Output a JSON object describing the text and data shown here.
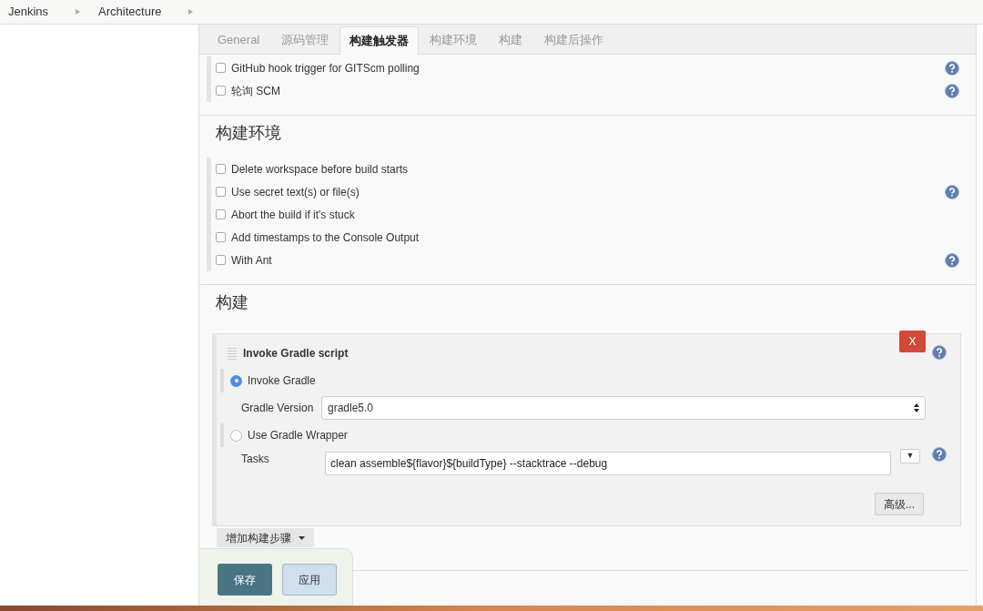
{
  "breadcrumbs": [
    "Jenkins",
    "Architecture"
  ],
  "tabs": [
    {
      "label": "General",
      "selected": false
    },
    {
      "label": "源码管理",
      "selected": false
    },
    {
      "label": "构建触发器",
      "selected": true
    },
    {
      "label": "构建环境",
      "selected": false
    },
    {
      "label": "构建",
      "selected": false
    },
    {
      "label": "构建后操作",
      "selected": false
    }
  ],
  "trigger_options": [
    {
      "label": "GitHub hook trigger for GITScm polling",
      "checked": false,
      "help": true
    },
    {
      "label": "轮询 SCM",
      "checked": false,
      "help": true
    }
  ],
  "environment": {
    "title": "构建环境",
    "options": [
      {
        "label": "Delete workspace before build starts",
        "checked": false,
        "help": false
      },
      {
        "label": "Use secret text(s) or file(s)",
        "checked": false,
        "help": true
      },
      {
        "label": "Abort the build if it's stuck",
        "checked": false,
        "help": false
      },
      {
        "label": "Add timestamps to the Console Output",
        "checked": false,
        "help": false
      },
      {
        "label": "With Ant",
        "checked": false,
        "help": true
      }
    ]
  },
  "build": {
    "title": "构建",
    "step": {
      "title": "Invoke Gradle script",
      "remove_button": "X",
      "modes": [
        {
          "label": "Invoke Gradle",
          "selected": true,
          "field_label": "Gradle Version",
          "field_value": "gradle5.0"
        },
        {
          "label": "Use Gradle Wrapper",
          "selected": false
        }
      ],
      "tasks_label": "Tasks",
      "tasks_value": "clean assemble${flavor}${buildType} --stacktrace --debug",
      "dropdown_button": "▼",
      "advanced_button": "高级..."
    },
    "add_step_button": "增加构建步骤"
  },
  "save_bar": {
    "buttons": [
      "保存",
      "应用"
    ]
  }
}
